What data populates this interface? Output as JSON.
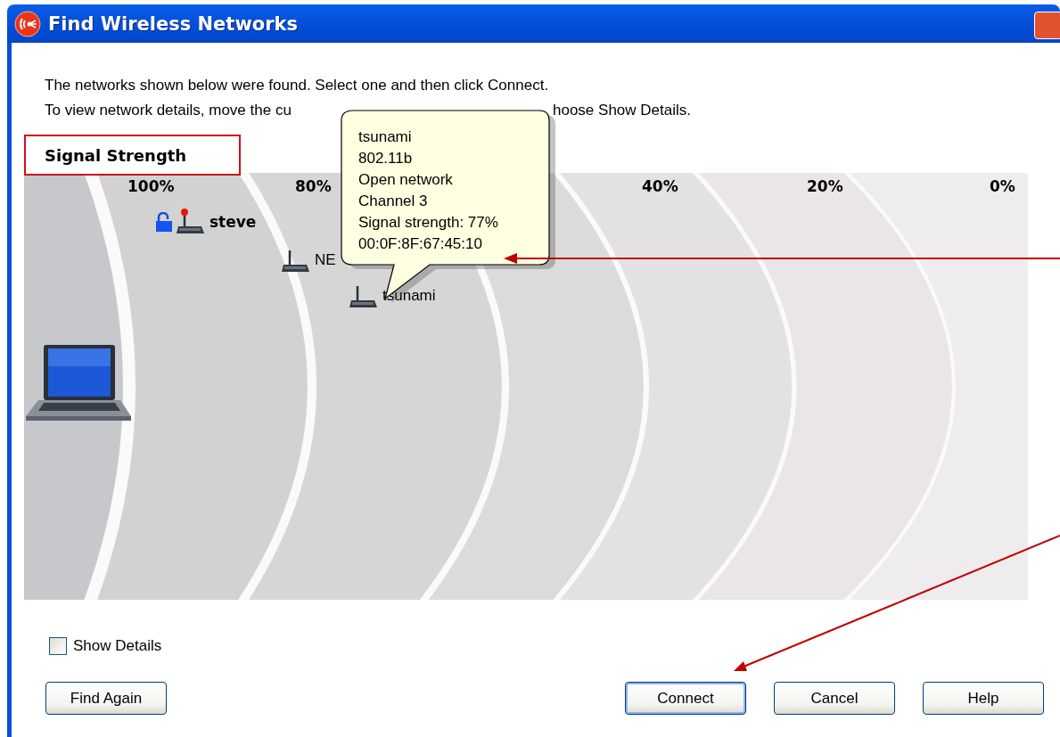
{
  "window": {
    "title": "Find Wireless Networks"
  },
  "intro_line_1": "The networks shown below were found. Select one and then click Connect.",
  "intro_line_2": {
    "before_tooltip": "To view network details, move the cu",
    "after_tooltip": "hoose Show Details."
  },
  "signal_panel": {
    "heading": "Signal Strength",
    "scale": [
      "100%",
      "80%",
      "40%",
      "20%",
      "0%"
    ],
    "networks": [
      {
        "name": "steve",
        "secured": true,
        "connected": true
      },
      {
        "name": "NE",
        "secured": false,
        "connected": false
      },
      {
        "name": "tsunami",
        "secured": false,
        "connected": false
      }
    ],
    "tooltip": {
      "lines": [
        "tsunami",
        "802.11b",
        "Open network",
        "Channel 3",
        "Signal strength: 77%",
        "00:0F:8F:67:45:10"
      ]
    }
  },
  "show_details": {
    "label": "Show Details",
    "checked": false
  },
  "buttons": [
    {
      "label": "Find Again",
      "default": false
    },
    {
      "label": "Connect",
      "default": true
    },
    {
      "label": "Cancel",
      "default": false
    },
    {
      "label": "Help",
      "default": false
    }
  ]
}
